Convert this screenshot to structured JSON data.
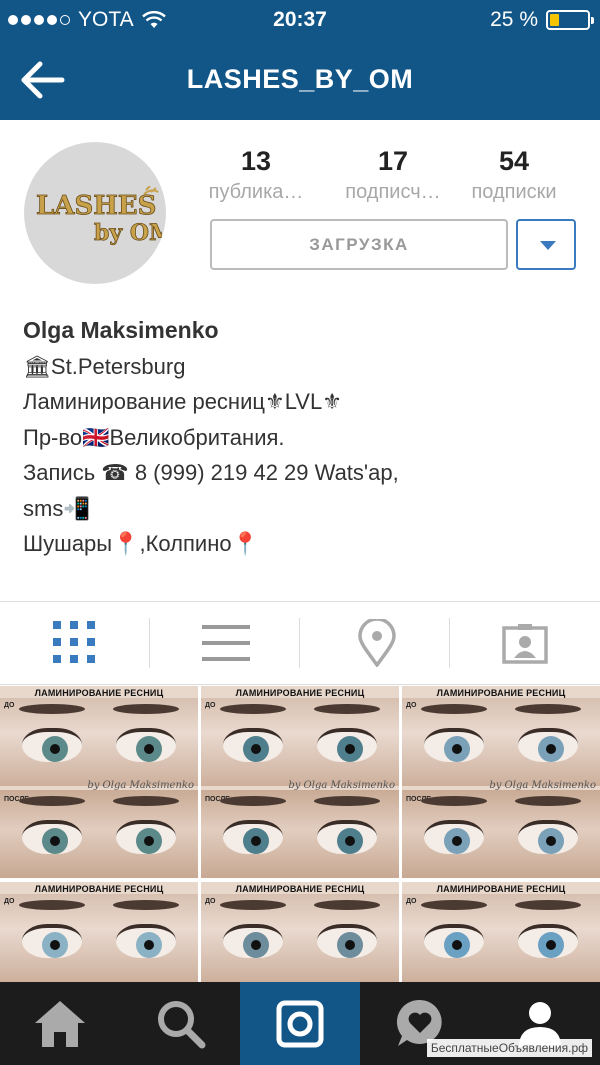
{
  "status_bar": {
    "carrier": "YOTA",
    "time": "20:37",
    "battery": "25 %",
    "battery_level": 0.25,
    "signal_bars_filled": 4,
    "signal_bars_total": 5
  },
  "nav": {
    "title": "LASHES_BY_OM",
    "back_icon": "back-arrow-icon"
  },
  "profile": {
    "avatar_logo_text": "LASHES by OM",
    "stats": [
      {
        "value": "13",
        "label": "публика…"
      },
      {
        "value": "17",
        "label": "подписч…"
      },
      {
        "value": "54",
        "label": "подписки"
      }
    ],
    "edit_button": "ЗАГРУЗКА",
    "dropdown_icon": "caret-down-icon"
  },
  "bio": {
    "name": "Olga Maksimenko",
    "lines": [
      "🏛St.Petersburg",
      "Ламинирование ресниц⚜LVL⚜",
      "Пр-во🇬🇧Великобритания.",
      "Запись ☎ 8 (999) 219 42 29 Wats'ap,",
      "sms📲",
      "Шушары📍,Колпино📍"
    ]
  },
  "tabs": [
    {
      "icon": "grid-icon",
      "active": true
    },
    {
      "icon": "list-icon",
      "active": false
    },
    {
      "icon": "location-pin-icon",
      "active": false
    },
    {
      "icon": "tagged-photos-icon",
      "active": false
    }
  ],
  "posts": [
    {
      "caption": "ЛАМИНИРОВАНИЕ РЕСНИЦ",
      "before": "ДО",
      "after": "ПОСЛЕ",
      "signature": "by Olga Maksimenko"
    },
    {
      "caption": "ЛАМИНИРОВАНИЕ РЕСНИЦ",
      "before": "ДО",
      "after": "ПОСЛЕ",
      "signature": "by Olga Maksimenko"
    },
    {
      "caption": "ЛАМИНИРОВАНИЕ РЕСНИЦ",
      "before": "ДО",
      "after": "ПОСЛЕ",
      "signature": "by Olga Maksimenko"
    },
    {
      "caption": "ЛАМИНИРОВАНИЕ РЕСНИЦ",
      "before": "ДО",
      "after": "",
      "signature": ""
    },
    {
      "caption": "ЛАМИНИРОВАНИЕ РЕСНИЦ",
      "before": "ДО",
      "after": "",
      "signature": ""
    },
    {
      "caption": "ЛАМИНИРОВАНИЕ РЕСНИЦ",
      "before": "ДО",
      "after": "",
      "signature": ""
    }
  ],
  "bottom_nav": [
    {
      "icon": "home-icon",
      "active": false
    },
    {
      "icon": "search-icon",
      "active": false
    },
    {
      "icon": "camera-icon",
      "active": true
    },
    {
      "icon": "heart-bubble-icon",
      "active": false
    },
    {
      "icon": "profile-icon",
      "active": false
    }
  ],
  "watermark": "БесплатныеОбъявления.рф",
  "colors": {
    "header": "#125688",
    "accent": "#3a7bbf",
    "bottom_bar": "#1c1c1c"
  }
}
